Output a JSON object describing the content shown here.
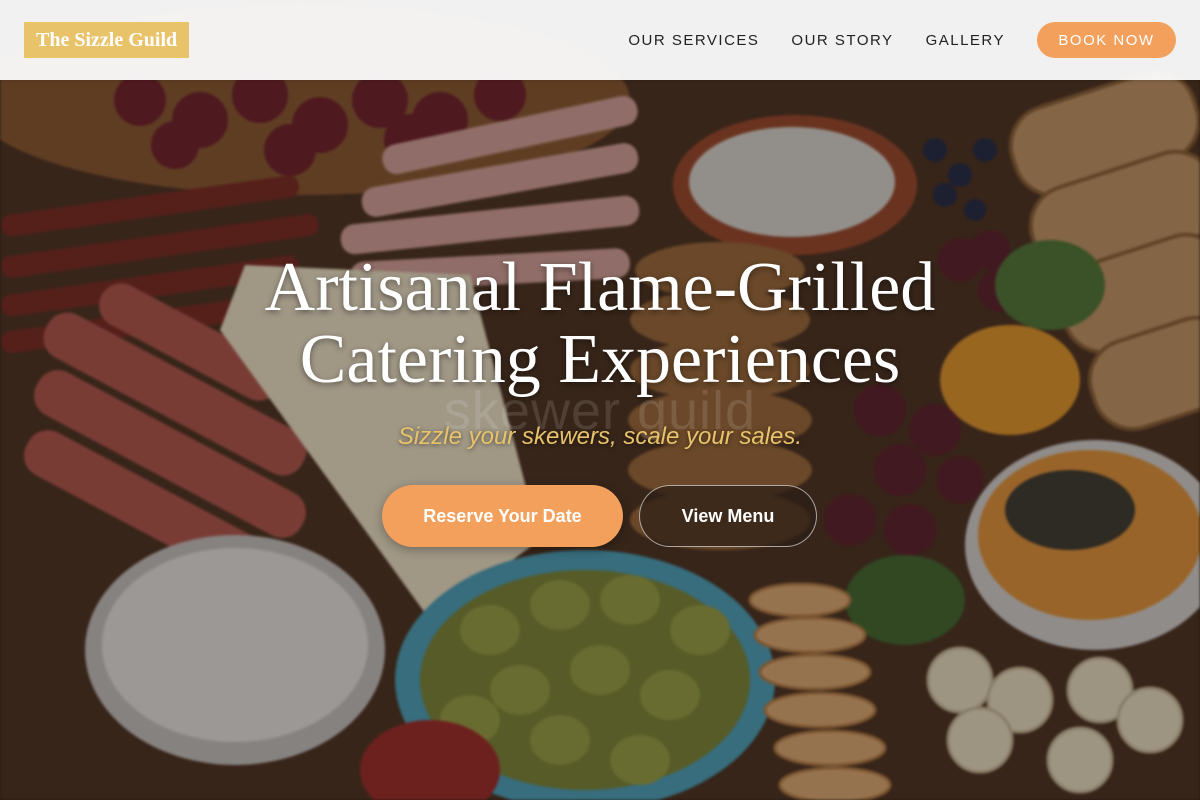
{
  "brand": {
    "name": "The Sizzle Guild"
  },
  "nav": {
    "links": [
      "OUR SERVICES",
      "OUR STORY",
      "GALLERY"
    ],
    "book_label": "BOOK NOW"
  },
  "hero": {
    "watermark": "skewer guild",
    "title_line1": "Artisanal Flame-Grilled",
    "title_line2": "Catering Experiences",
    "tagline": "Sizzle your skewers, scale your sales.",
    "primary_cta": "Reserve Your Date",
    "secondary_cta": "View Menu"
  },
  "colors": {
    "accent": "#f2a05c",
    "logo_bg": "#e9c36a",
    "tagline": "#e9c36a"
  }
}
